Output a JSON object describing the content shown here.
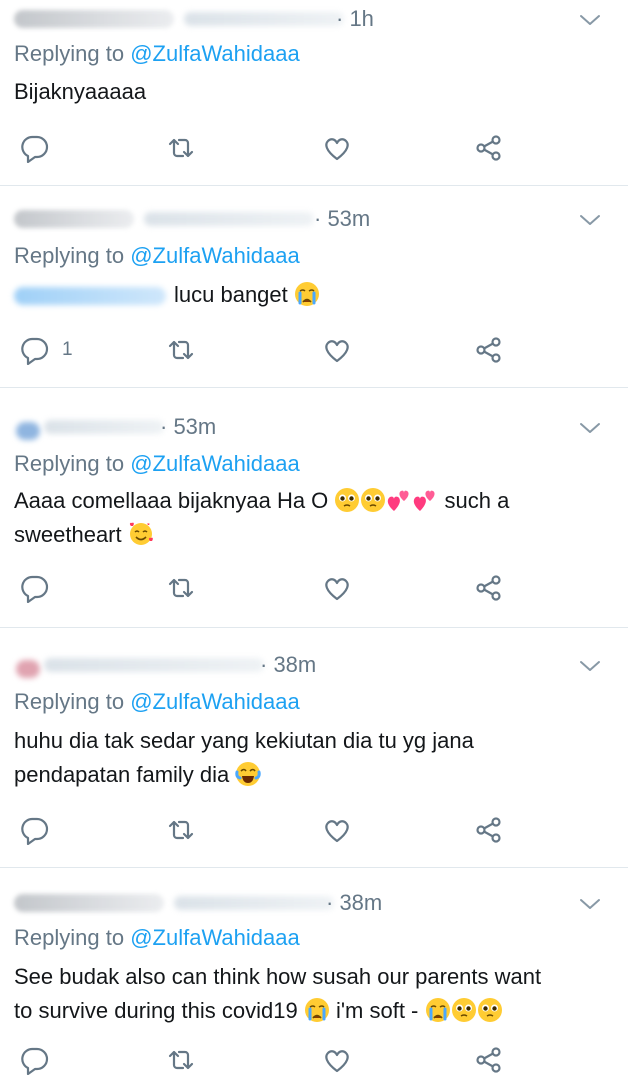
{
  "replying_prefix": "Replying to",
  "replying_handle": "@ZulfaWahidaaa",
  "tweets": [
    {
      "time": "· 1h",
      "text": "Bijaknyaaaaa",
      "reply_count": ""
    },
    {
      "time": "· 53m",
      "text": "lucu banget",
      "reply_count": "1"
    },
    {
      "time": "· 53m",
      "text_line1": "Aaaa comellaaa bijaknyaa Ha O",
      "text_line1_end": "such a",
      "text_line2": "sweetheart",
      "reply_count": ""
    },
    {
      "time": "· 38m",
      "text_line1": "huhu dia tak sedar yang kekiutan dia tu yg jana",
      "text_line2": "pendapatan family dia",
      "reply_count": ""
    },
    {
      "time": "· 38m",
      "text_line1": "See budak also can think how susah our parents want",
      "text_line2": "to survive during this covid19",
      "text_line2_end": "i'm soft -",
      "reply_count": ""
    }
  ],
  "colors": {
    "accent": "#1da1f2",
    "secondary_text": "#657786",
    "divider": "#e1e8ed"
  },
  "icons": [
    "chevron-down-icon",
    "reply-icon",
    "retweet-icon",
    "like-icon",
    "share-icon"
  ]
}
